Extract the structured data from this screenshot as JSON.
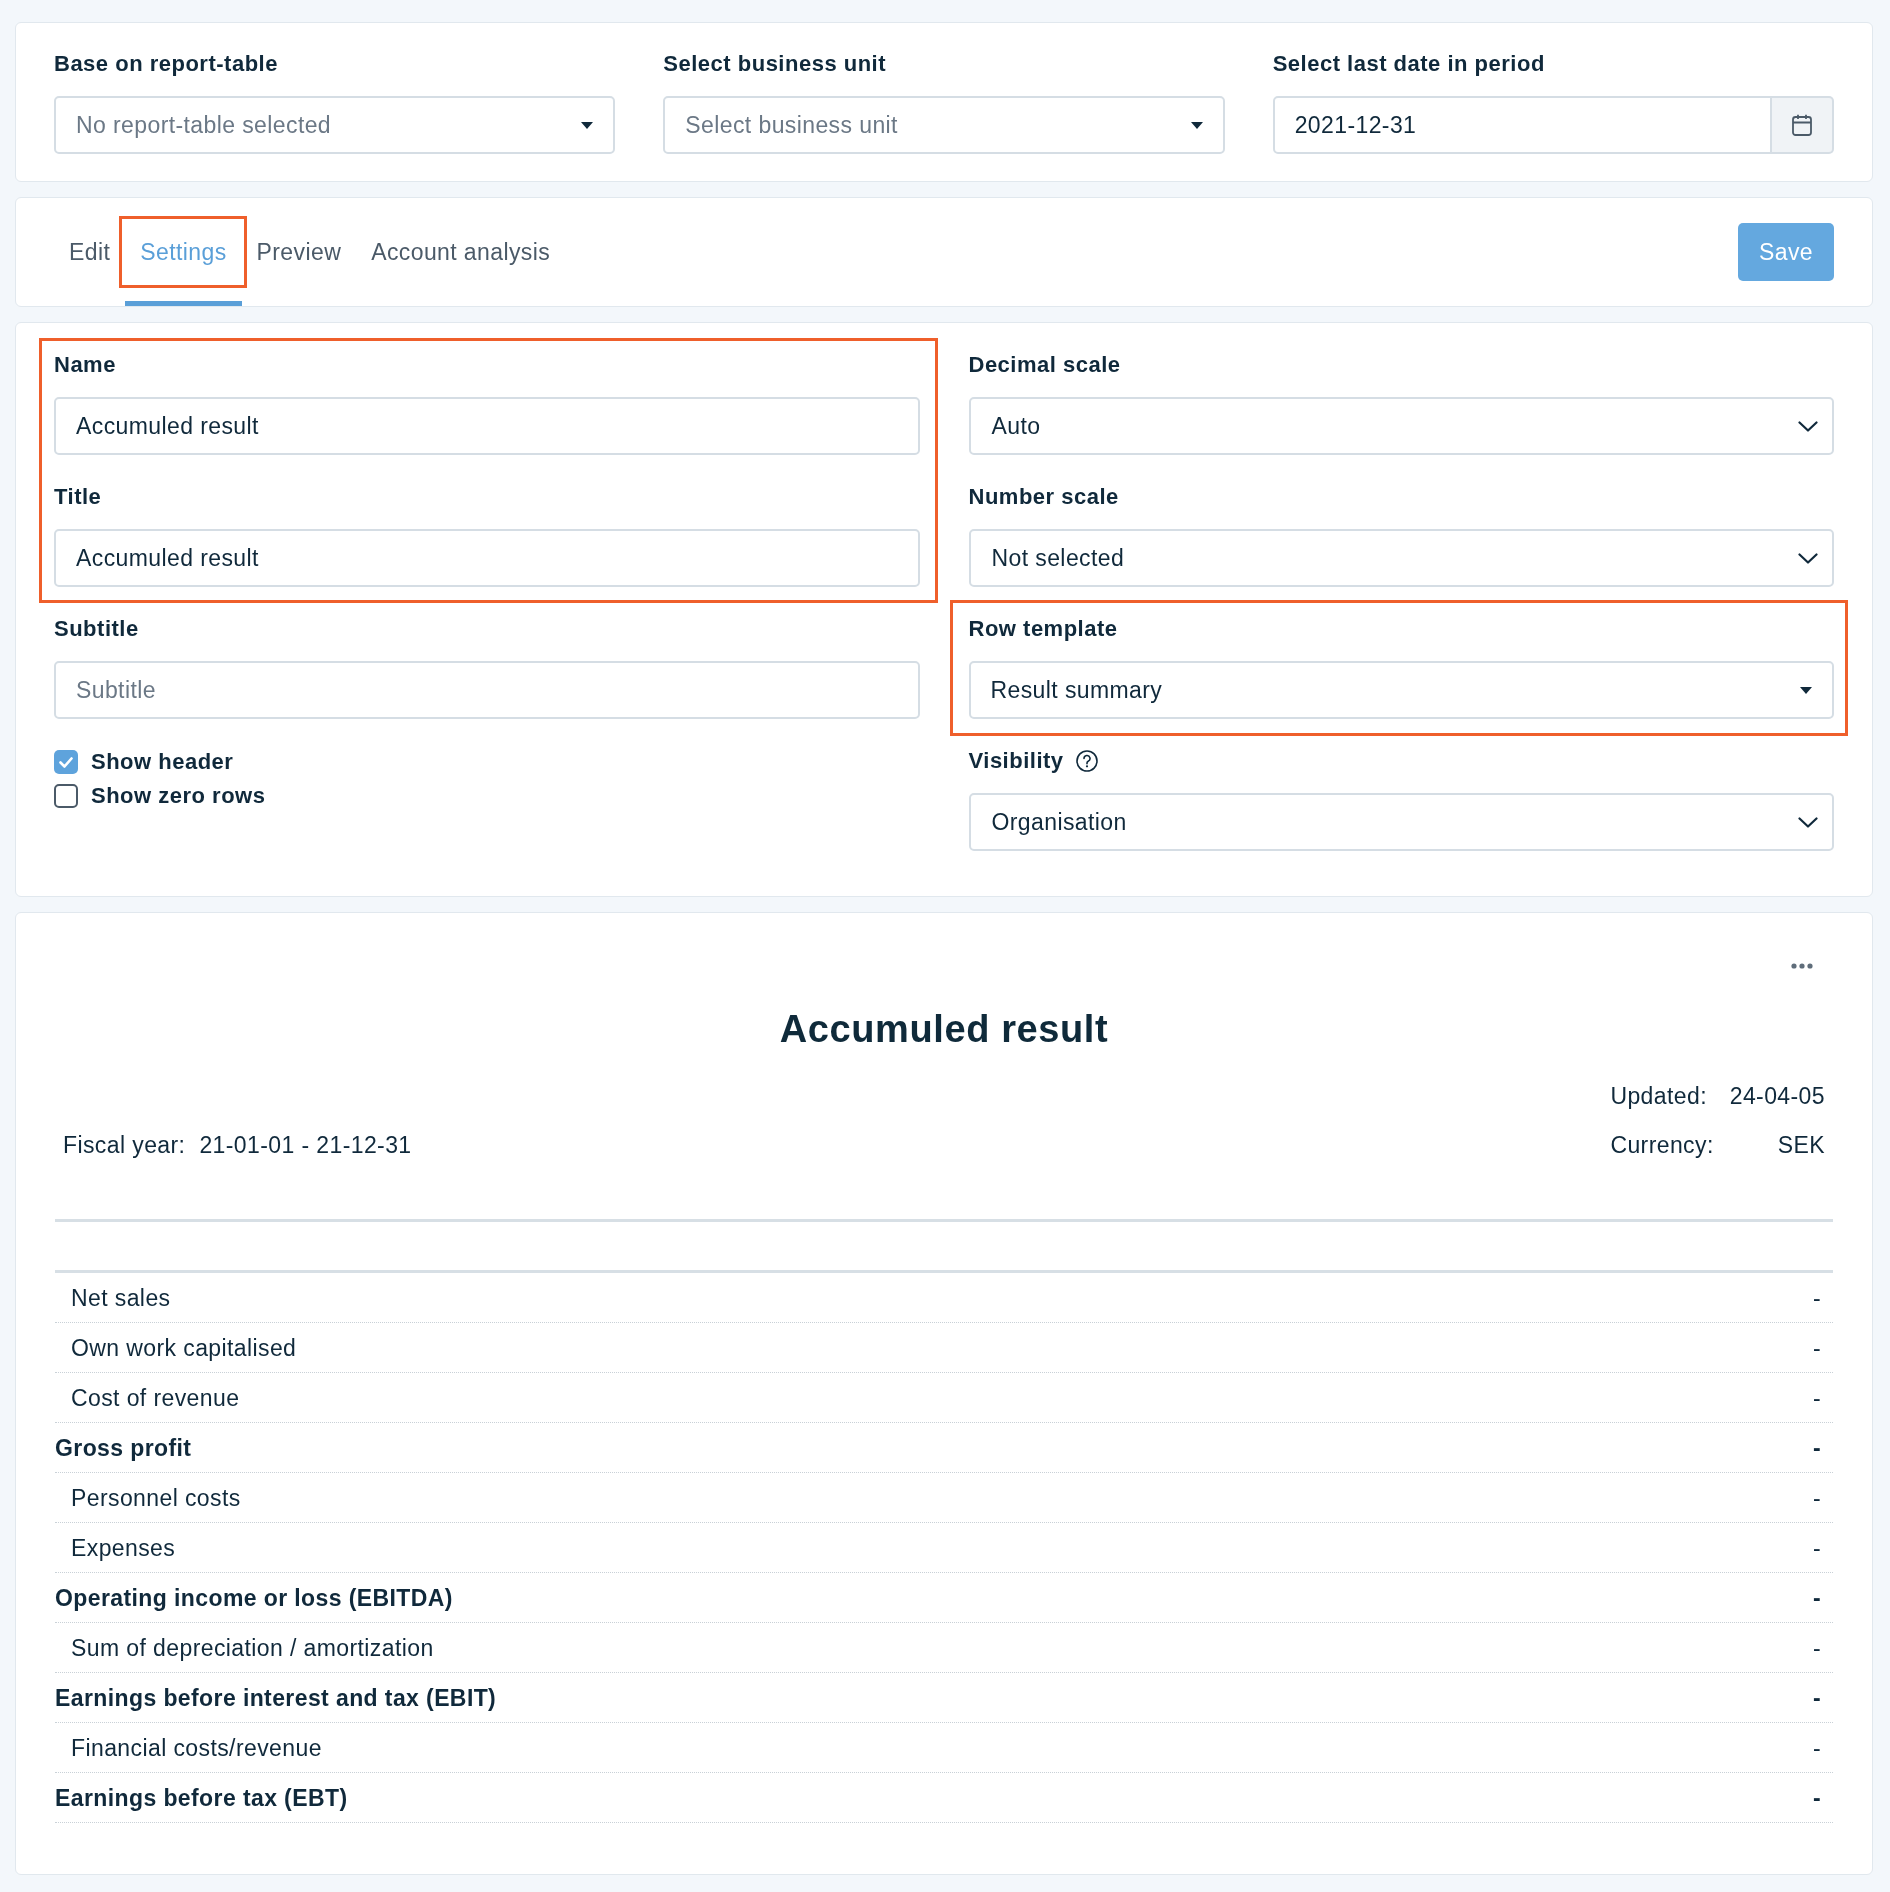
{
  "filters": [
    {
      "kind": "combobox",
      "label": "Base on report-table",
      "placeholder": "No report-table selected"
    },
    {
      "kind": "combobox",
      "label": "Select business unit",
      "placeholder": "Select business unit"
    },
    {
      "kind": "date",
      "label": "Select last date in period",
      "value": "2021-12-31"
    }
  ],
  "tabs": [
    {
      "label": "Edit",
      "selected": false,
      "highlighted": false
    },
    {
      "label": "Settings",
      "selected": true,
      "highlighted": true
    },
    {
      "label": "Preview",
      "selected": false,
      "highlighted": false
    },
    {
      "label": "Account analysis",
      "selected": false,
      "highlighted": false
    }
  ],
  "save_button": {
    "label": "Save"
  },
  "settings": {
    "left": [
      {
        "highlighted": true,
        "fields": [
          {
            "kind": "text",
            "label": "Name",
            "value": "Accumuled result"
          },
          {
            "kind": "text",
            "label": "Title",
            "value": "Accumuled result"
          }
        ]
      },
      {
        "highlighted": false,
        "fields": [
          {
            "kind": "text",
            "label": "Subtitle",
            "placeholder": "Subtitle"
          }
        ]
      },
      {
        "highlighted": false,
        "fields": [
          {
            "kind": "checkbox",
            "label": "Show header",
            "checked": true
          },
          {
            "kind": "checkbox",
            "label": "Show zero rows",
            "checked": false
          }
        ]
      }
    ],
    "right": [
      {
        "highlighted": false,
        "fields": [
          {
            "kind": "select",
            "label": "Decimal scale",
            "value": "Auto"
          },
          {
            "kind": "select",
            "label": "Number scale",
            "value": "Not selected"
          }
        ]
      },
      {
        "highlighted": true,
        "fields": [
          {
            "kind": "combobox",
            "label": "Row template",
            "value": "Result summary"
          }
        ]
      },
      {
        "highlighted": false,
        "fields": [
          {
            "kind": "select",
            "label": "Visibility",
            "value": "Organisation",
            "help": true
          }
        ]
      }
    ]
  },
  "report": {
    "title": "Accumuled result",
    "meta_left": [
      {
        "label": "Fiscal year:",
        "value": "21-01-01 - 21-12-31"
      }
    ],
    "meta_right": [
      {
        "label": "Updated:",
        "value": "24-04-05"
      },
      {
        "label": "Currency:",
        "value": "SEK"
      }
    ],
    "rows": [
      {
        "kind": "item",
        "label": "Net sales",
        "value": "-"
      },
      {
        "kind": "item",
        "label": "Own work capitalised",
        "value": "-"
      },
      {
        "kind": "item",
        "label": "Cost of revenue",
        "value": "-"
      },
      {
        "kind": "total",
        "label": "Gross profit",
        "value": "-"
      },
      {
        "kind": "item",
        "label": "Personnel costs",
        "value": "-"
      },
      {
        "kind": "item",
        "label": "Expenses",
        "value": "-"
      },
      {
        "kind": "total",
        "label": "Operating income or loss (EBITDA)",
        "value": "-"
      },
      {
        "kind": "item",
        "label": "Sum of depreciation / amortization",
        "value": "-"
      },
      {
        "kind": "total",
        "label": "Earnings before interest and tax (EBIT)",
        "value": "-"
      },
      {
        "kind": "item",
        "label": "Financial costs/revenue",
        "value": "-"
      },
      {
        "kind": "total",
        "label": "Earnings before tax (EBT)",
        "value": "-"
      }
    ]
  }
}
